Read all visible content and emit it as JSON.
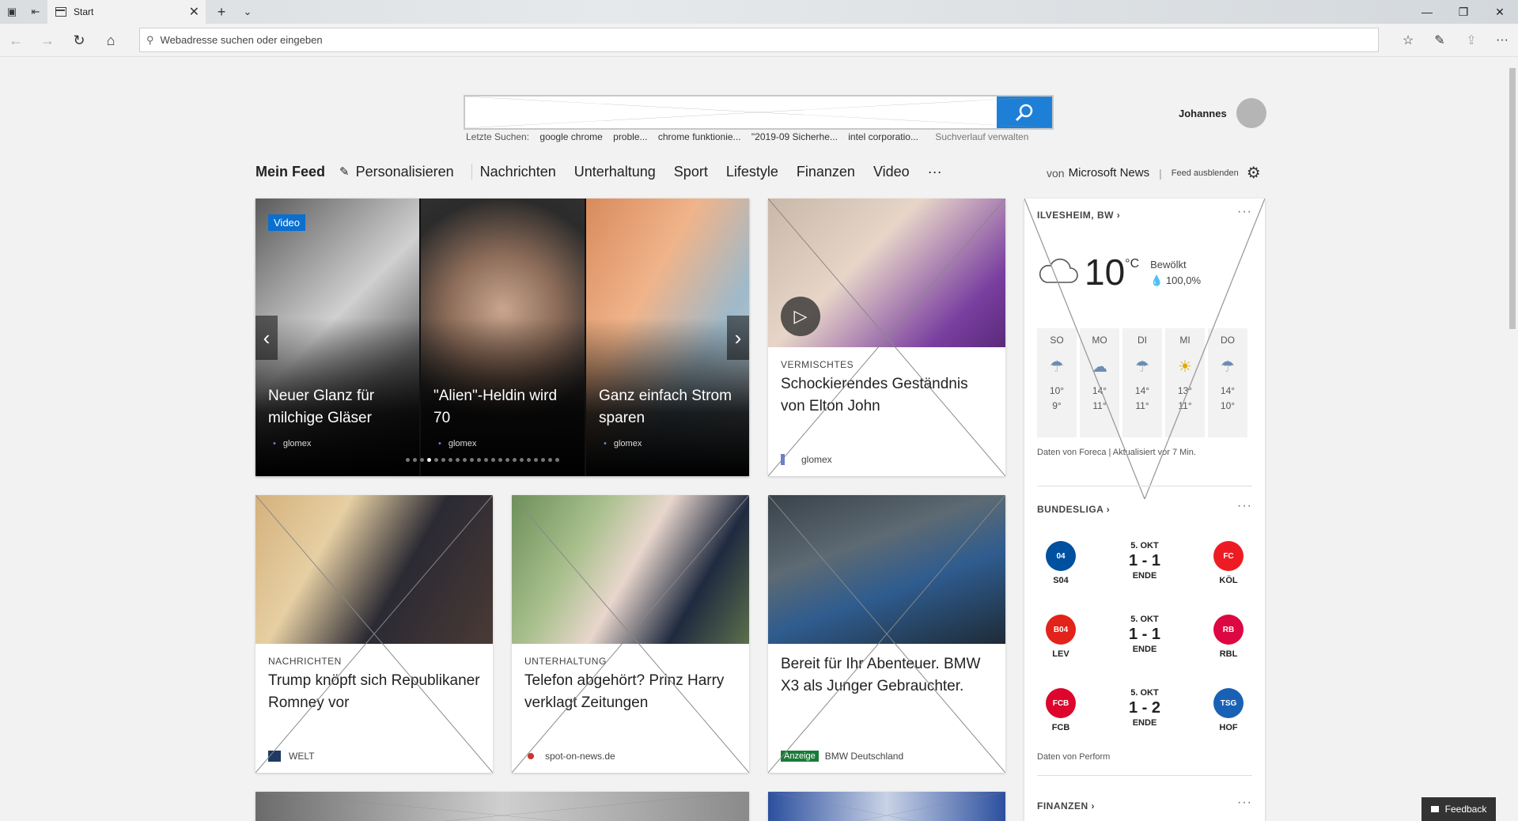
{
  "browser": {
    "tab_title": "Start",
    "address_placeholder": "Webadresse suchen oder eingeben"
  },
  "search": {
    "placeholder": "",
    "recent_label": "Letzte Suchen:",
    "recent": [
      "google chrome",
      "proble...",
      "chrome funktionie...",
      "\"2019-09 Sicherhe...",
      "intel corporatio..."
    ],
    "manage": "Suchverlauf verwalten"
  },
  "user": {
    "name": "Johannes"
  },
  "feednav": {
    "mein_feed": "Mein Feed",
    "personalize": "Personalisieren",
    "items": [
      "Nachrichten",
      "Unterhaltung",
      "Sport",
      "Lifestyle",
      "Finanzen",
      "Video"
    ],
    "more": "···",
    "by_label": "von",
    "by_brand": "Microsoft News",
    "hide": "Feed ausblenden"
  },
  "carousel": {
    "badge": "Video",
    "slides": [
      {
        "title": "Neuer Glanz für milchige Gläser",
        "source": "glomex"
      },
      {
        "title": "\"Alien\"-Heldin wird 70",
        "source": "glomex"
      },
      {
        "title": "Ganz einfach Strom sparen",
        "source": "glomex"
      }
    ]
  },
  "cards": [
    {
      "category": "VERMISCHTES",
      "title": "Schockierendes Geständnis von Elton John",
      "source": "glomex"
    },
    {
      "category": "NACHRICHTEN",
      "title": "Trump knöpft sich Republikaner Romney vor",
      "source": "WELT"
    },
    {
      "category": "UNTERHALTUNG",
      "title": "Telefon abgehört? Prinz Harry verklagt Zeitungen",
      "source": "spot-on-news.de"
    },
    {
      "category": "",
      "title": "Bereit für Ihr Abenteuer. BMW X3 als Junger Gebrauchter.",
      "badge": "Anzeige",
      "source": "BMW Deutschland"
    }
  ],
  "weather": {
    "location": "ILVESHEIM, BW",
    "temp": "10",
    "unit": "°C",
    "condition": "Bewölkt",
    "precip": "100,0%",
    "days": [
      {
        "name": "SO",
        "hi": "10°",
        "lo": "9°",
        "icon": "rain-icon"
      },
      {
        "name": "MO",
        "hi": "14°",
        "lo": "11°",
        "icon": "cloud-icon"
      },
      {
        "name": "DI",
        "hi": "14°",
        "lo": "11°",
        "icon": "rain-icon"
      },
      {
        "name": "MI",
        "hi": "13°",
        "lo": "11°",
        "icon": "sun-rain-icon"
      },
      {
        "name": "DO",
        "hi": "14°",
        "lo": "10°",
        "icon": "rain-icon"
      }
    ],
    "footer": "Daten von Foreca | Aktualisiert vor 7 Min."
  },
  "bundesliga": {
    "title": "BUNDESLIGA",
    "matches": [
      {
        "home": "S04",
        "away": "KÖL",
        "date": "5. OKT",
        "score": "1 - 1",
        "status": "ENDE",
        "home_color": "#0050a0",
        "away_color": "#ed1c24"
      },
      {
        "home": "LEV",
        "away": "RBL",
        "date": "5. OKT",
        "score": "1 - 1",
        "status": "ENDE",
        "home_color": "#e32219",
        "away_color": "#dd0741"
      },
      {
        "home": "FCB",
        "away": "HOF",
        "date": "5. OKT",
        "score": "1 - 2",
        "status": "ENDE",
        "home_color": "#dc052d",
        "away_color": "#1961b5"
      }
    ],
    "footer": "Daten von Perform"
  },
  "finance": {
    "title": "FINANZEN"
  },
  "feedback": "Feedback"
}
